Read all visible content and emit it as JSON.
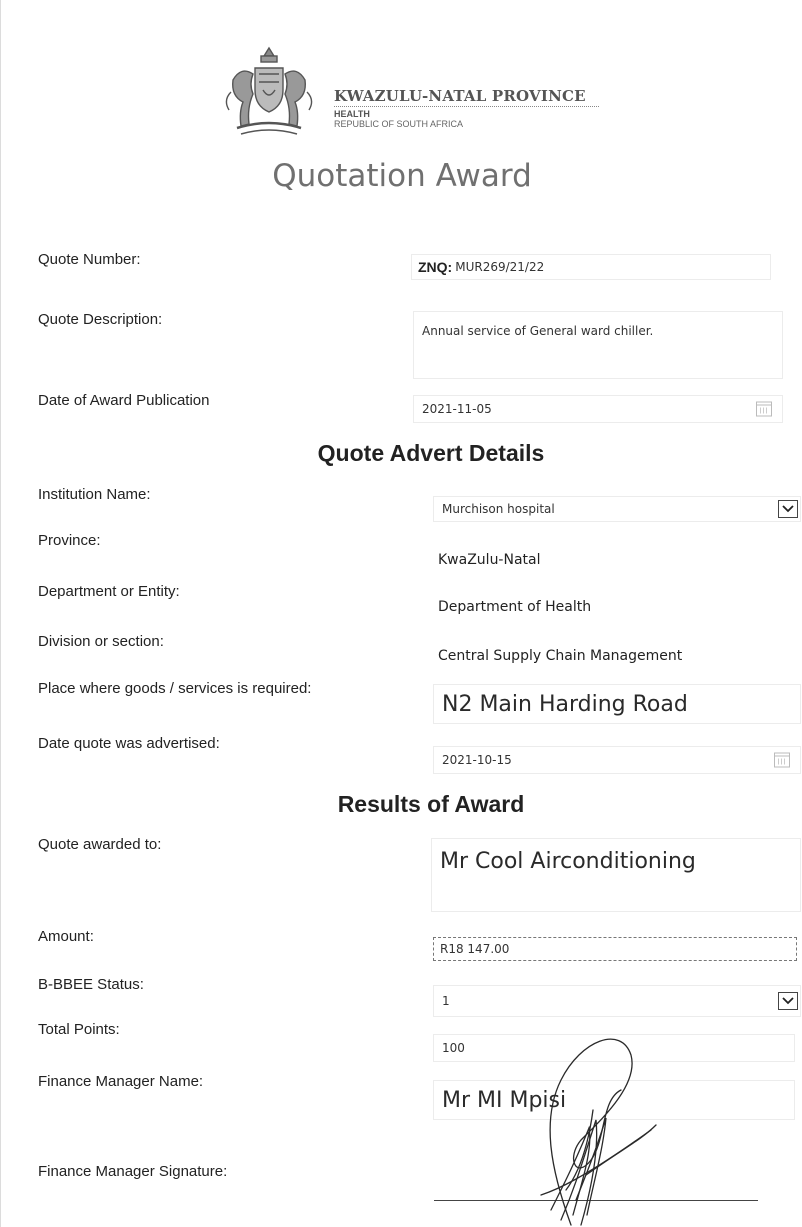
{
  "header": {
    "org": "KWAZULU-NATAL PROVINCE",
    "dept": "HEALTH",
    "country": "REPUBLIC OF SOUTH AFRICA",
    "title": "Quotation Award"
  },
  "quote": {
    "number_label": "Quote Number:",
    "number_prefix": "ZNQ:",
    "number_value": "MUR269/21/22",
    "description_label": "Quote Description:",
    "description_value": "Annual service of General ward chiller.",
    "publication_label": "Date of Award Publication",
    "publication_value": "2021-11-05"
  },
  "advert": {
    "heading": "Quote Advert Details",
    "institution_label": "Institution Name:",
    "institution_value": "Murchison hospital",
    "province_label": "Province:",
    "province_value": "KwaZulu-Natal",
    "department_label": "Department or Entity:",
    "department_value": "Department of Health",
    "division_label": "Division or section:",
    "division_value": "Central Supply Chain Management",
    "place_label": "Place where goods /  services is required:",
    "place_value": "N2 Main Harding Road",
    "advertised_label": "Date quote was advertised:",
    "advertised_value": "2021-10-15"
  },
  "results": {
    "heading": "Results of Award",
    "awarded_label": "Quote awarded to:",
    "awarded_value": "Mr Cool Airconditioning",
    "amount_label": "Amount:",
    "amount_value": "R18 147.00",
    "bbbee_label": "B-BBEE Status:",
    "bbbee_value": "1",
    "points_label": "Total Points:",
    "points_value": "100",
    "fm_name_label": "Finance Manager Name:",
    "fm_name_value": "Mr MI Mpisi",
    "fm_sig_label": "Finance Manager Signature:"
  },
  "icons": {
    "crest": "coat-of-arms-icon",
    "calendar": "calendar-icon",
    "dropdown": "chevron-down-icon",
    "signature": "handwritten-signature"
  }
}
